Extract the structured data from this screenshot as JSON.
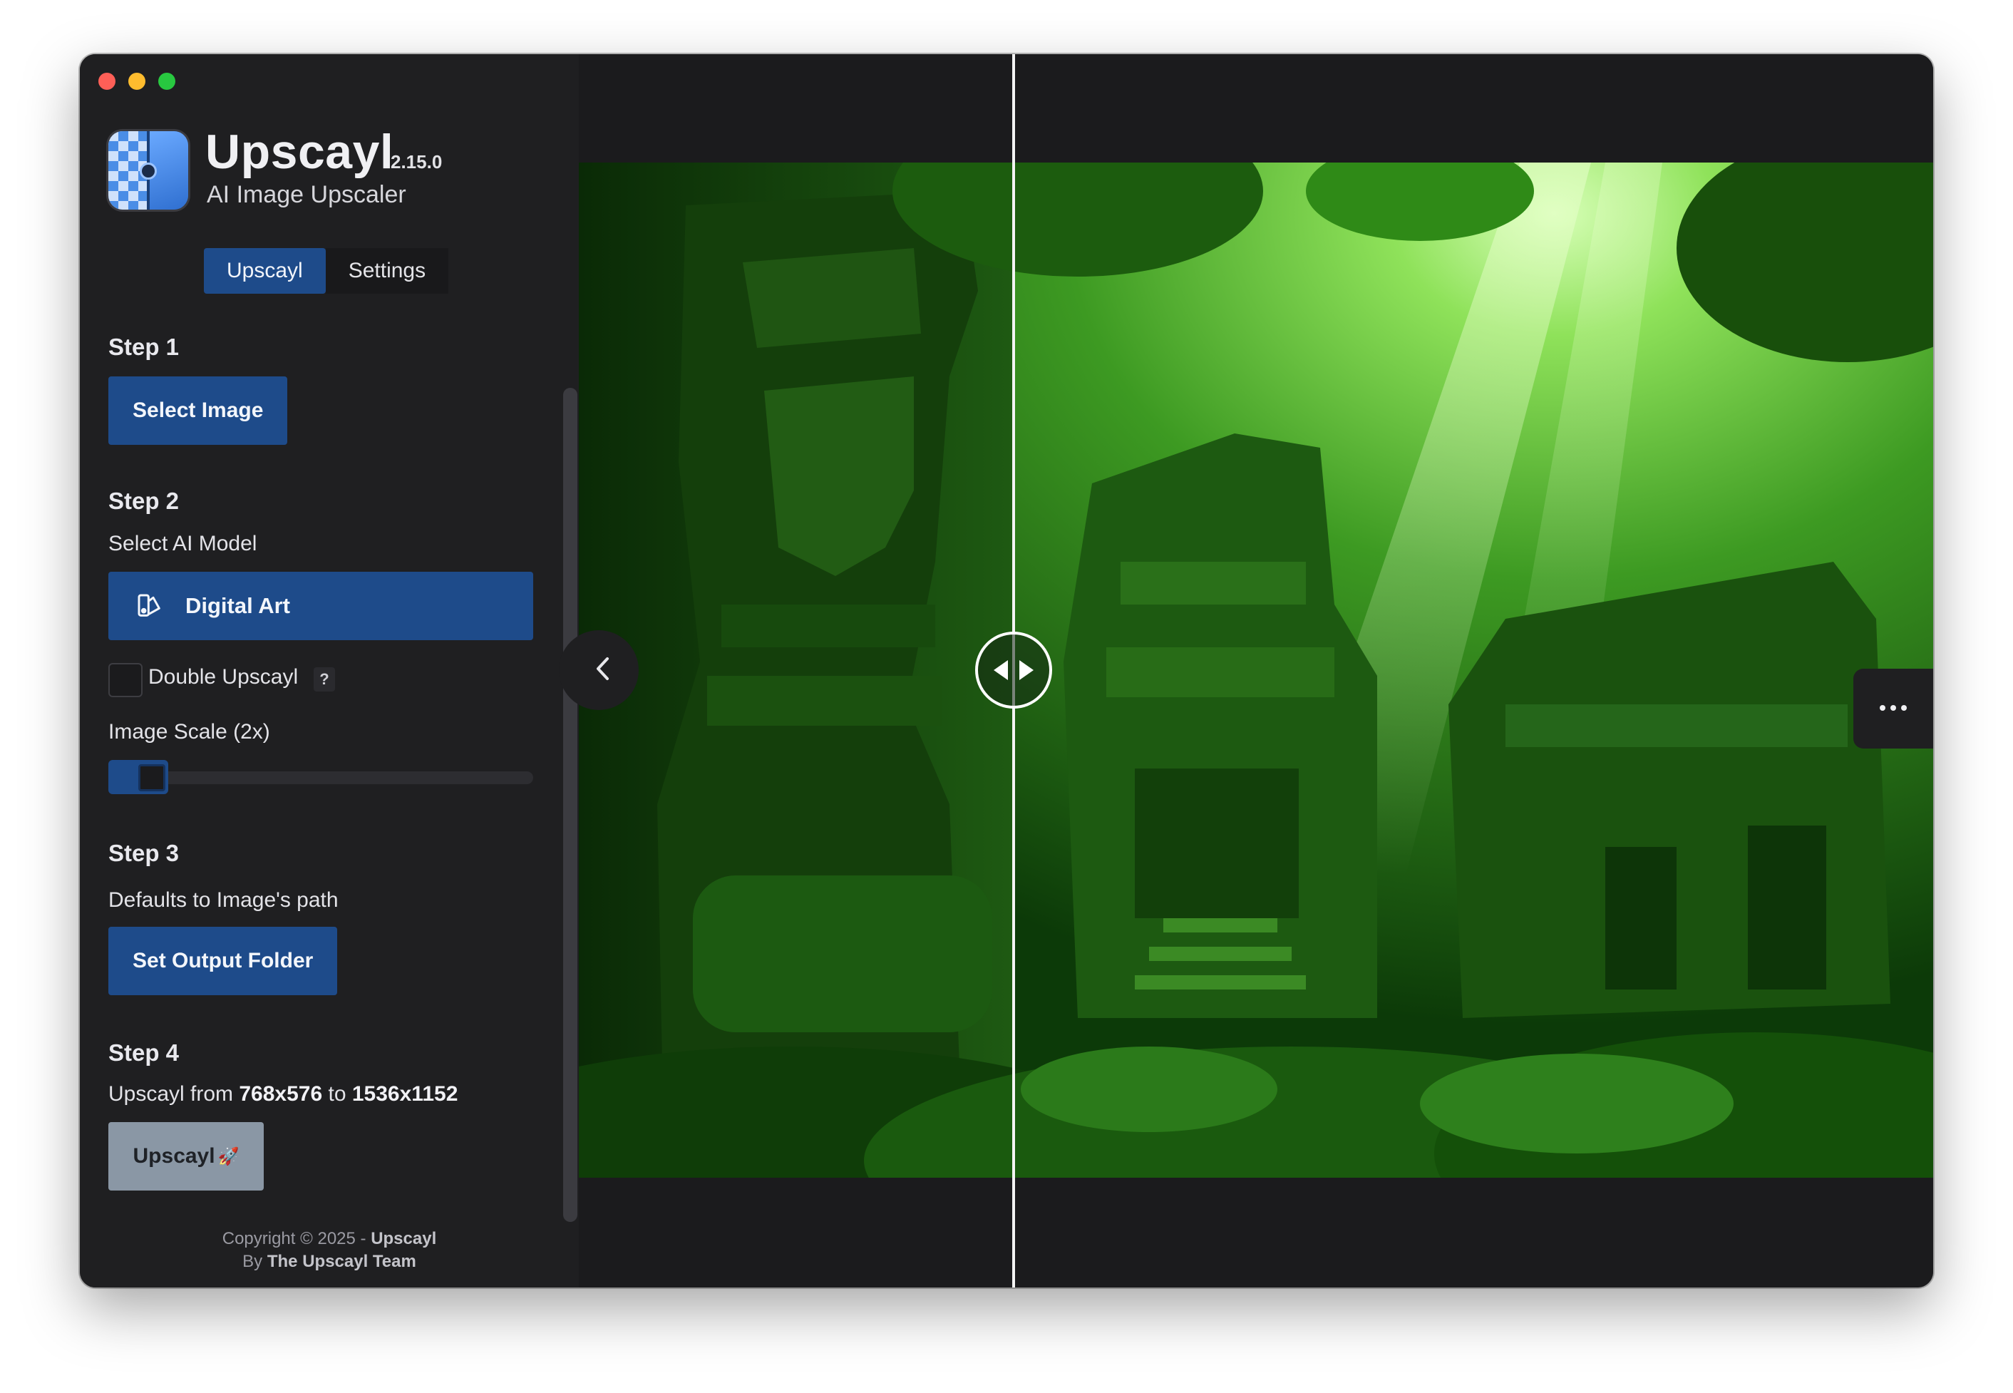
{
  "app": {
    "name": "Upscayl",
    "version": "2.15.0",
    "subtitle": "AI Image Upscaler"
  },
  "tabs": [
    {
      "label": "Upscayl",
      "active": true
    },
    {
      "label": "Settings",
      "active": false
    }
  ],
  "step1": {
    "title": "Step 1",
    "button": "Select Image"
  },
  "step2": {
    "title": "Step 2",
    "model_label": "Select AI Model",
    "model_value": "Digital Art",
    "double_upscayl_label": "Double Upscayl",
    "double_upscayl_checked": false,
    "help_badge": "?",
    "scale_label": "Image Scale (2x)",
    "scale_value": 2
  },
  "step3": {
    "title": "Step 3",
    "hint": "Defaults to Image's path",
    "button": "Set Output Folder"
  },
  "step4": {
    "title": "Step 4",
    "prefix": "Upscayl from ",
    "from": "768x576",
    "middle": " to ",
    "to": "1536x1152",
    "button": "Upscayl",
    "button_emoji": "🚀"
  },
  "footer": {
    "copyright": "Copyright © 2025 - ",
    "brand": "Upscayl",
    "by": "By ",
    "team": "The Upscayl Team"
  },
  "colors": {
    "accent": "#1e4b8a",
    "sidebar_bg": "#1f1f21",
    "disabled_button": "#8a97a5"
  },
  "icons": {
    "model": "palette-icon",
    "collapse": "chevron-left-icon",
    "compare": "compare-arrows-icon",
    "more": "more-horizontal-icon"
  }
}
